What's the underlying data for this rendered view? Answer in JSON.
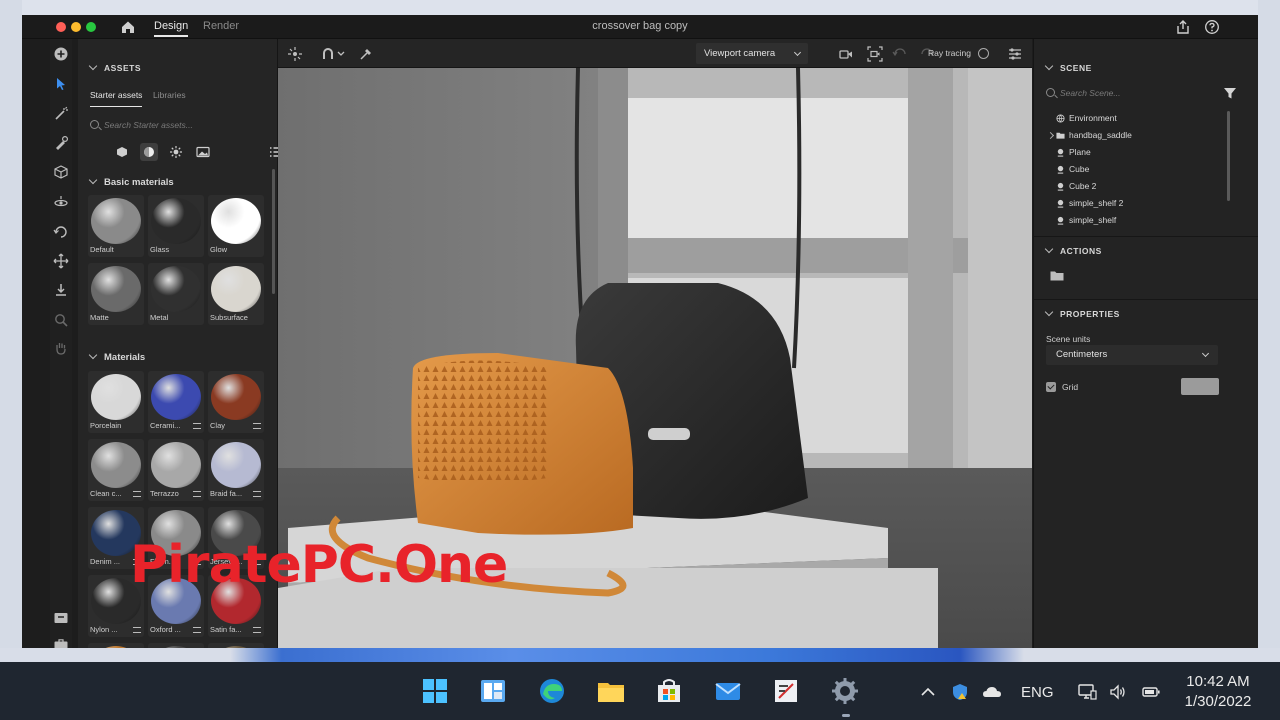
{
  "window": {
    "tabs": [
      "Design",
      "Render"
    ],
    "doc_title": "crossover bag copy"
  },
  "assets": {
    "header": "ASSETS",
    "subtabs": [
      "Starter assets",
      "Libraries"
    ],
    "search_placeholder": "Search Starter assets...",
    "basic_header": "Basic materials",
    "basic": [
      {
        "label": "Default",
        "color": "#8a8a8a"
      },
      {
        "label": "Glass",
        "color": "#2a2a2a"
      },
      {
        "label": "Glow",
        "color": "#ffffff"
      },
      {
        "label": "Matte",
        "color": "#6a6a6a"
      },
      {
        "label": "Metal",
        "color": "#303030"
      },
      {
        "label": "Subsurface",
        "color": "#d9d6cf"
      }
    ],
    "materials_header": "Materials",
    "materials": [
      {
        "label": "Porcelain",
        "color": "#d8d8d8"
      },
      {
        "label": "Cerami...",
        "color": "#3c4ab0"
      },
      {
        "label": "Clay",
        "color": "#8a3a22"
      },
      {
        "label": "Clean c...",
        "color": "#8c8c8c"
      },
      {
        "label": "Terrazzo",
        "color": "#a8a8a8"
      },
      {
        "label": "Braid fa...",
        "color": "#b6bad2"
      },
      {
        "label": "Denim ...",
        "color": "#24385e"
      },
      {
        "label": "Flann...",
        "color": "#8a8a8a"
      },
      {
        "label": "Jersey f...",
        "color": "#4a4a4a"
      },
      {
        "label": "Nylon ...",
        "color": "#2a2a2a"
      },
      {
        "label": "Oxford ...",
        "color": "#6a7ab0"
      },
      {
        "label": "Satin fa...",
        "color": "#b2282e"
      },
      {
        "label": "",
        "color": "#c07a30"
      },
      {
        "label": "",
        "color": "#4a4a4a"
      },
      {
        "label": "",
        "color": "#6a5a40"
      }
    ]
  },
  "viewport": {
    "camera": "Viewport camera",
    "ray_tracing": "Ray tracing"
  },
  "scene": {
    "header": "SCENE",
    "search_placeholder": "Search Scene...",
    "items": [
      "Environment",
      "handbag_saddle",
      "Plane",
      "Cube",
      "Cube 2",
      "simple_shelf 2",
      "simple_shelf"
    ],
    "actions_header": "ACTIONS",
    "properties_header": "PROPERTIES",
    "scene_units_label": "Scene units",
    "scene_units_value": "Centimeters",
    "grid_label": "Grid"
  },
  "watermark": "PiratePC.One",
  "taskbar": {
    "lang": "ENG",
    "time": "10:42 AM",
    "date": "1/30/2022"
  }
}
